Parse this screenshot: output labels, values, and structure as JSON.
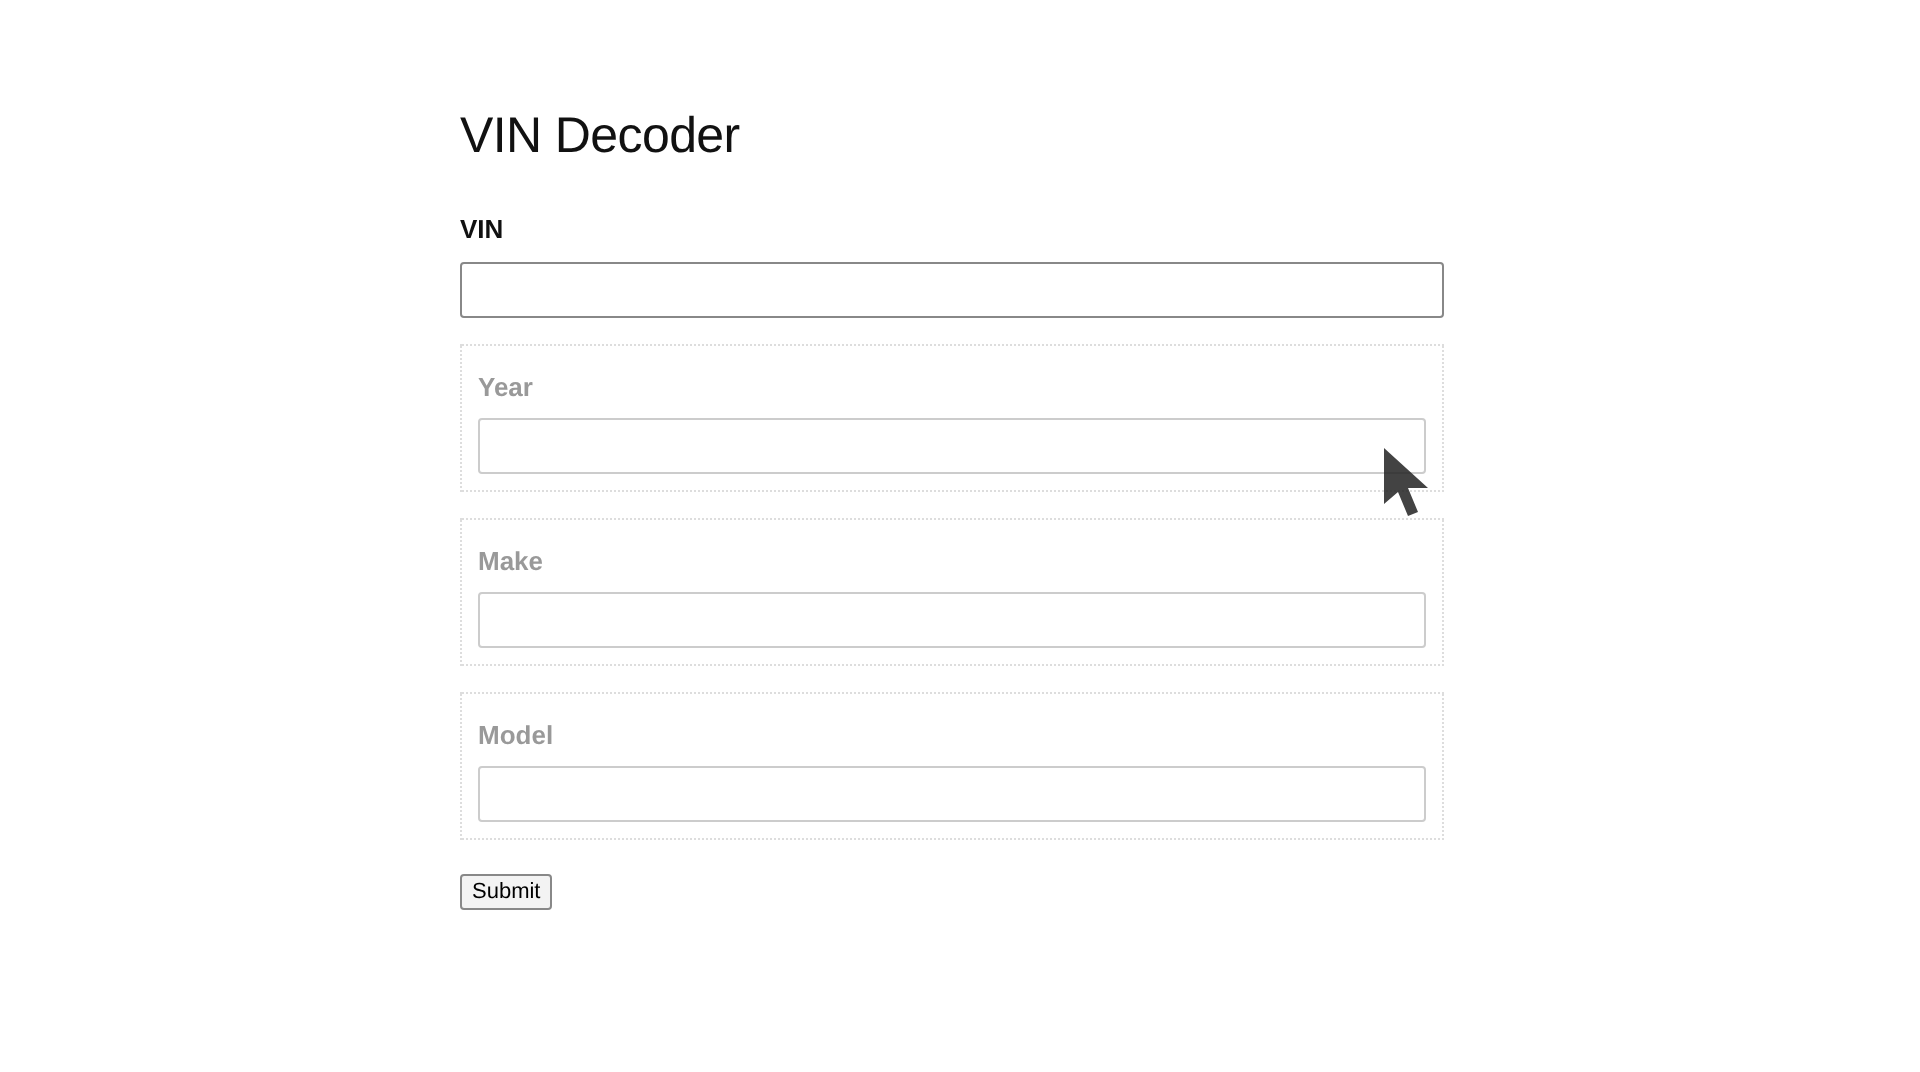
{
  "title": "VIN Decoder",
  "vin": {
    "label": "VIN",
    "disabled": false
  },
  "fields": [
    {
      "label": "Year",
      "disabled": true
    },
    {
      "label": "Make",
      "disabled": true
    },
    {
      "label": "Model",
      "disabled": true
    }
  ],
  "submit": {
    "label": "Submit"
  }
}
